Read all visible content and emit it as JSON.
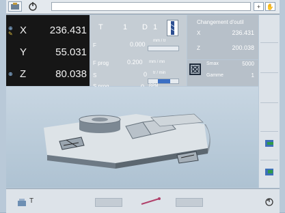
{
  "position": {
    "x": {
      "label": "X",
      "value": "236.431"
    },
    "y": {
      "label": "Y",
      "value": "55.031"
    },
    "z": {
      "label": "Z",
      "value": "80.038"
    }
  },
  "tool": {
    "t_label": "T",
    "t_value": "1",
    "d_label": "D",
    "d_value": "1",
    "f_label": "F",
    "f_value": "0.000",
    "f_unit": "mm / tr",
    "fprog_label": "F prog",
    "fprog_value": "0.200",
    "fprog_unit": "mm / mn",
    "s_label": "S",
    "s_value": "0",
    "s_unit": "tr / min",
    "sprog_label": "S prog",
    "sprog_value": "0",
    "sprog_unit": "RPM"
  },
  "tool_change": {
    "title": "Changement d'outil",
    "x_label": "X",
    "x_value": "236.431",
    "z_label": "Z",
    "z_value": "200.038"
  },
  "spindle": {
    "smax_label": "Smax",
    "smax_value": "5000",
    "gamme_label": "Gamme",
    "gamme_value": "1"
  },
  "bottom": {
    "t_label": "T"
  },
  "colors": {
    "position_bg": "#161616",
    "panel_bg": "#c5cdd4",
    "accent_blue": "#3b6fc4"
  }
}
